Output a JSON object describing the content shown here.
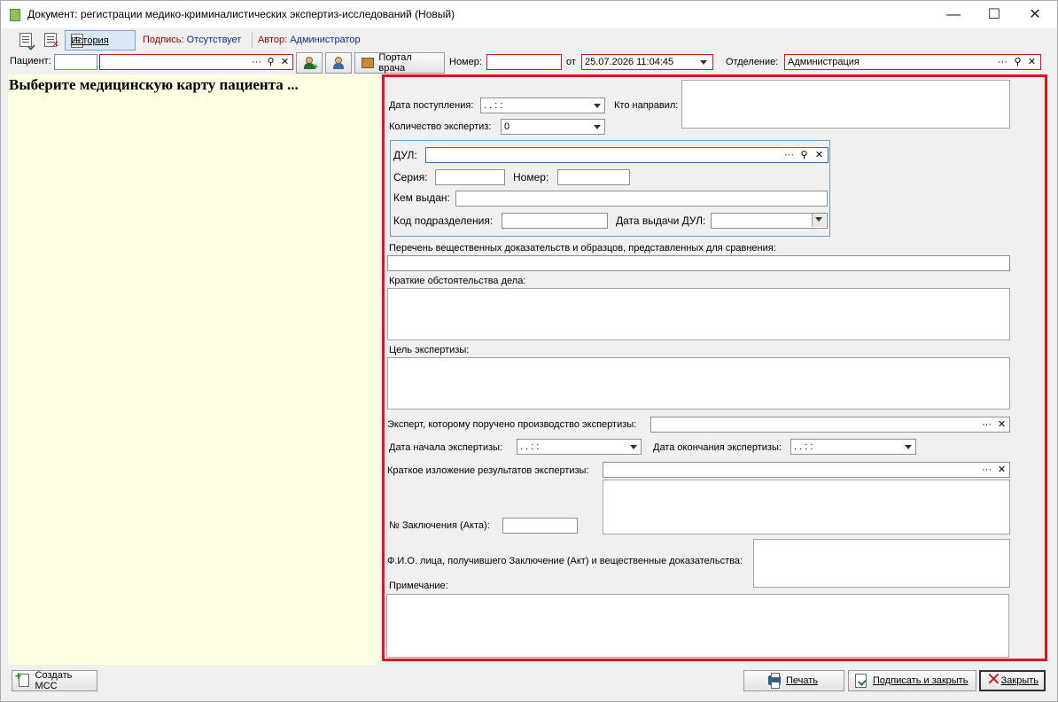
{
  "window": {
    "title": "Документ: регистрации медико-криминалистических экспертиз-исследований (Новый)",
    "minimize": "—",
    "maximize": "☐",
    "close": "✕"
  },
  "toolbar": {
    "history_label": "История",
    "sign_label": "Подпись:",
    "sign_value": "Отсутствует",
    "author_label": "Автор:",
    "author_value": "Администратор"
  },
  "patientbar": {
    "patient_label": "Пациент:",
    "patient_code": "",
    "patient_name": "",
    "portal_label": "Портал врача",
    "number_label": "Номер:",
    "number_value": "",
    "from_label": "от",
    "date_value": "25.07.2026 11:04:45",
    "department_label": "Отделение:",
    "department_value": "Администрация"
  },
  "left": {
    "message": "Выберите медицинскую карту пациента ..."
  },
  "form": {
    "arrival_date_label": "Дата поступления:",
    "arrival_date_value": " .  .      :  :",
    "sent_by_label": "Кто направил:",
    "count_label": "Количество экспертиз:",
    "count_value": "0",
    "dul_label": "ДУЛ:",
    "series_label": "Серия:",
    "number_label": "Номер:",
    "issued_by_label": "Кем выдан:",
    "dept_code_label": "Код подразделения:",
    "issue_date_label": "Дата выдачи ДУЛ:",
    "evidence_label": "Перечень вещественных доказательств и образцов, представленных для сравнения:",
    "circumstances_label": "Краткие обстоятельства дела:",
    "purpose_label": "Цель экспертизы:",
    "expert_label": "Эксперт, которому поручено производство экспертизы:",
    "start_date_label": "Дата начала экспертизы:",
    "start_date_value": " .  .      :  :",
    "end_date_label": "Дата окончания экспертизы:",
    "end_date_value": " .  .      :  :",
    "summary_label": "Краткое изложение результатов экспертизы:",
    "conclusion_label": "№ Заключения (Акта):",
    "recipient_label": "Ф.И.О. лица, получившего Заключение (Акт) и вещественные доказательства:",
    "note_label": "Примечание:"
  },
  "footer": {
    "create_mss": "Создать МСС",
    "print": "Печать",
    "sign_close": "Подписать и закрыть",
    "close": "Закрыть"
  }
}
